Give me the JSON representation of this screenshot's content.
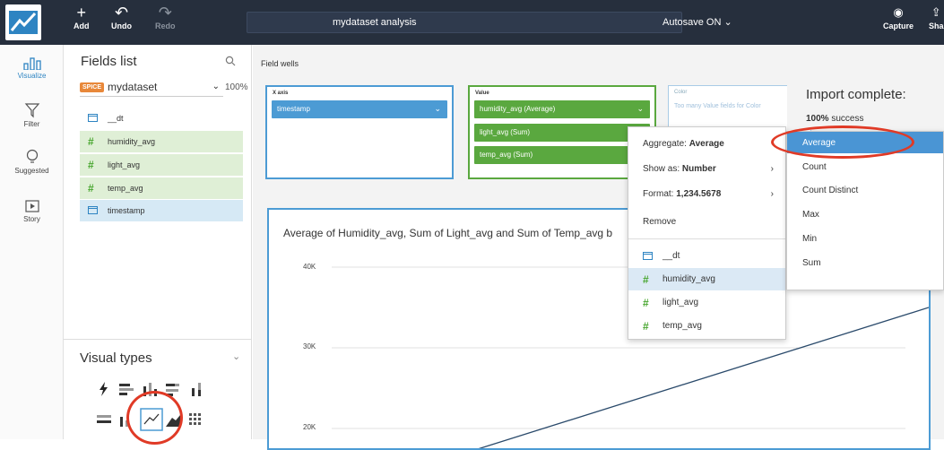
{
  "toolbar": {
    "add_label": "Add",
    "undo_label": "Undo",
    "redo_label": "Redo",
    "analysis_title": "mydataset analysis",
    "autosave_label": "Autosave ON",
    "capture_label": "Capture",
    "share_label": "Sha"
  },
  "nav": {
    "items": [
      {
        "label": "Visualize",
        "icon": "bar-chart-icon",
        "active": true
      },
      {
        "label": "Filter",
        "icon": "filter-icon"
      },
      {
        "label": "Suggested",
        "icon": "lightbulb-icon"
      },
      {
        "label": "Story",
        "icon": "story-icon"
      }
    ]
  },
  "fields_panel": {
    "title": "Fields list",
    "spice_badge": "SPICE",
    "dataset": "mydataset",
    "percent": "100%",
    "fields": [
      {
        "name": "__dt",
        "type": "date"
      },
      {
        "name": "humidity_avg",
        "type": "number"
      },
      {
        "name": "light_avg",
        "type": "number"
      },
      {
        "name": "temp_avg",
        "type": "number"
      },
      {
        "name": "timestamp",
        "type": "date"
      }
    ]
  },
  "visual_types": {
    "title": "Visual types",
    "selected": "line-chart"
  },
  "field_wells": {
    "label": "Field wells",
    "x_axis": {
      "label": "X axis",
      "value": "timestamp"
    },
    "value": {
      "label": "Value",
      "items": [
        "humidity_avg (Average)",
        "light_avg (Sum)",
        "temp_avg (Sum)"
      ]
    },
    "color": {
      "label": "Color",
      "placeholder": "Too many Value fields for Color"
    }
  },
  "chart": {
    "title": "Average of Humidity_avg, Sum of Light_avg and Sum of Temp_avg b",
    "y_ticks": [
      "40K",
      "30K",
      "20K"
    ]
  },
  "chart_data": {
    "type": "line",
    "title": "Average of Humidity_avg, Sum of Light_avg and Sum of Temp_avg b",
    "y_ticks": [
      40000,
      30000,
      20000
    ],
    "series": [
      {
        "x": [
          0,
          1
        ],
        "values": [
          17000,
          35000
        ]
      }
    ]
  },
  "aggregate_menu": {
    "aggregate_prefix": "Aggregate:",
    "aggregate_value": "Average",
    "show_as_prefix": "Show as:",
    "show_as_value": "Number",
    "format_prefix": "Format:",
    "format_value": "1,234.5678",
    "remove_label": "Remove",
    "fields": [
      {
        "name": "__dt",
        "type": "date"
      },
      {
        "name": "humidity_avg",
        "type": "number",
        "highlighted": true
      },
      {
        "name": "light_avg",
        "type": "number"
      },
      {
        "name": "temp_avg",
        "type": "number"
      }
    ]
  },
  "aggregate_options": [
    "Average",
    "Count",
    "Count Distinct",
    "Max",
    "Min",
    "Sum"
  ],
  "aggregate_selected": "Average",
  "toast": {
    "title": "Import complete:",
    "pct": "100%",
    "text": "success"
  },
  "colors": {
    "topbar": "#262f3d",
    "accent_blue": "#4c9bd4",
    "accent_green": "#5aa83f",
    "highlight_red": "#e03a26"
  }
}
